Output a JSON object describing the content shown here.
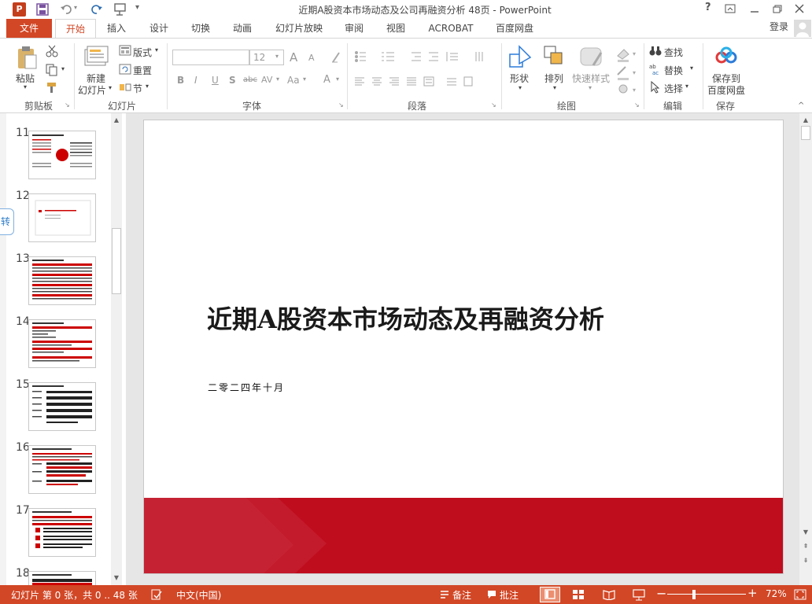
{
  "window": {
    "title": "近期A股资本市场动态及公司再融资分析 48页 - PowerPoint",
    "app_icon": "P",
    "help": "?",
    "controls": [
      "ribbon-display-icon",
      "minimize-icon",
      "restore-icon",
      "close-icon"
    ]
  },
  "menu": {
    "tabs": [
      "文件",
      "开始",
      "插入",
      "设计",
      "切换",
      "动画",
      "幻灯片放映",
      "审阅",
      "视图",
      "ACROBAT",
      "百度网盘"
    ],
    "active": "开始",
    "login": "登录"
  },
  "ribbon": {
    "clipboard": {
      "paste": "粘贴",
      "label": "剪贴板"
    },
    "slides": {
      "new_slide_1": "新建",
      "new_slide_2": "幻灯片",
      "layout": "版式",
      "reset": "重置",
      "section": "节",
      "label": "幻灯片"
    },
    "font": {
      "size": "12",
      "grow": "A",
      "shrink": "A",
      "bold": "B",
      "italic": "I",
      "underline": "U",
      "shadow": "S",
      "strike": "abc",
      "spacing": "AV",
      "case": "Aa",
      "color": "A",
      "label": "字体"
    },
    "paragraph": {
      "label": "段落"
    },
    "drawing": {
      "shapes": "形状",
      "arrange": "排列",
      "quick_styles": "快速样式",
      "label": "绘图"
    },
    "editing": {
      "find": "查找",
      "replace": "替换",
      "select": "选择",
      "label": "编辑"
    },
    "save": {
      "save_1": "保存到",
      "save_2": "百度网盘",
      "label": "保存"
    }
  },
  "thumbnails": {
    "numbers": [
      "11",
      "12",
      "13",
      "14",
      "15",
      "16",
      "17",
      "18"
    ]
  },
  "side_tab": "转",
  "slide": {
    "title": "近期A股资本市场动态及再融资分析",
    "subtitle": "二零二四年十月",
    "band_color": "#c00d1e"
  },
  "status": {
    "slide_info": "幻灯片 第 0 张，共 0 .. 48 张",
    "language": "中文(中国)",
    "notes": "备注",
    "comments": "批注",
    "zoom": "72%",
    "zoom_level_percent": 72
  },
  "colors": {
    "accent": "#d24726",
    "slide_red": "#c00d1e"
  }
}
